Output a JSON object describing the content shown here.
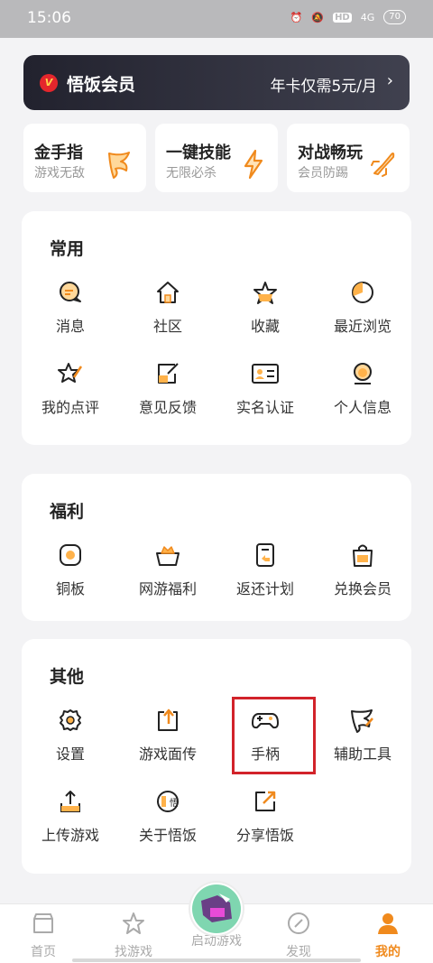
{
  "status_bar": {
    "time": "15:06",
    "network": "4G",
    "battery": "70"
  },
  "vip": {
    "badge": "V",
    "title": "悟饭会员",
    "promo": "年卡仅需5元/月",
    "arrow": "›"
  },
  "features": [
    {
      "title": "金手指",
      "subtitle": "游戏无敌",
      "icon": "golden-finger-icon"
    },
    {
      "title": "一键技能",
      "subtitle": "无限必杀",
      "icon": "lightning-icon"
    },
    {
      "title": "对战畅玩",
      "subtitle": "会员防踢",
      "icon": "rocket-icon"
    }
  ],
  "common": {
    "title": "常用",
    "items": [
      {
        "label": "消息",
        "icon": "message-icon"
      },
      {
        "label": "社区",
        "icon": "community-icon"
      },
      {
        "label": "收藏",
        "icon": "favorite-icon"
      },
      {
        "label": "最近浏览",
        "icon": "recent-icon"
      },
      {
        "label": "我的点评",
        "icon": "review-icon"
      },
      {
        "label": "意见反馈",
        "icon": "feedback-icon"
      },
      {
        "label": "实名认证",
        "icon": "id-card-icon"
      },
      {
        "label": "个人信息",
        "icon": "profile-icon"
      }
    ]
  },
  "welfare": {
    "title": "福利",
    "items": [
      {
        "label": "铜板",
        "icon": "coin-icon"
      },
      {
        "label": "网游福利",
        "icon": "gift-basket-icon"
      },
      {
        "label": "返还计划",
        "icon": "return-plan-icon"
      },
      {
        "label": "兑换会员",
        "icon": "vip-bag-icon"
      }
    ]
  },
  "other": {
    "title": "其他",
    "items": [
      {
        "label": "设置",
        "icon": "gear-icon"
      },
      {
        "label": "游戏面传",
        "icon": "share-game-icon"
      },
      {
        "label": "手柄",
        "icon": "gamepad-icon"
      },
      {
        "label": "辅助工具",
        "icon": "wing-icon"
      },
      {
        "label": "上传游戏",
        "icon": "upload-icon"
      },
      {
        "label": "关于悟饭",
        "icon": "about-icon"
      },
      {
        "label": "分享悟饭",
        "icon": "share-icon"
      }
    ]
  },
  "nav": {
    "items": [
      {
        "label": "首页",
        "icon": "home-icon"
      },
      {
        "label": "找游戏",
        "icon": "star-icon"
      },
      {
        "label": "启动游戏",
        "icon": "launch-game-icon"
      },
      {
        "label": "发现",
        "icon": "compass-icon"
      },
      {
        "label": "我的",
        "icon": "user-icon",
        "active": true
      }
    ]
  },
  "colors": {
    "accent": "#f08a1d",
    "highlight_box": "#d2232a",
    "vip_bg": "#2a2a36"
  }
}
